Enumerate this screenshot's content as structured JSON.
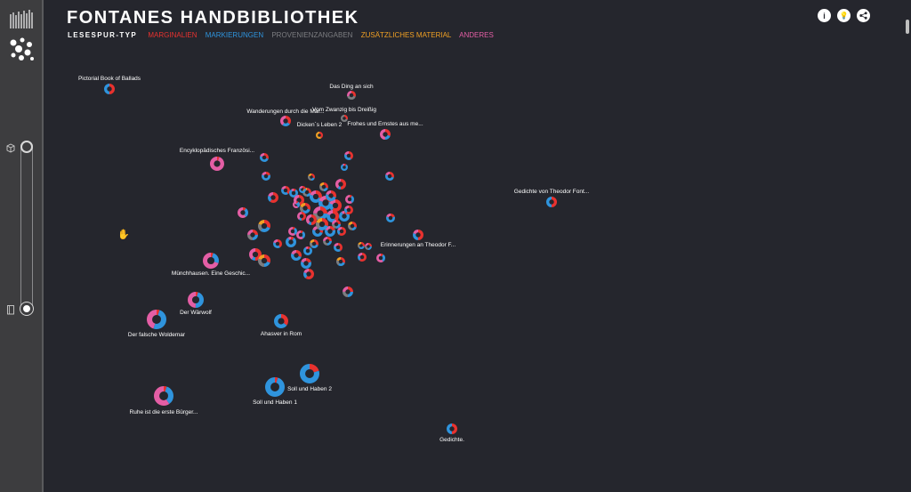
{
  "app": {
    "title": "FONTANES HANDBIBLIOTHEK"
  },
  "legend": {
    "label": "LESESPUR-TYP",
    "items": [
      {
        "label": "MARGINALIEN",
        "color": "#e8322f"
      },
      {
        "label": "MARKIERUNGEN",
        "color": "#2f94dd"
      },
      {
        "label": "PROVENIENZANGABEN",
        "color": "#7c7d80"
      },
      {
        "label": "ZUSÄTZLICHES MATERIAL",
        "color": "#f0a024"
      },
      {
        "label": "ANDERES",
        "color": "#e45ea5"
      }
    ]
  },
  "toolbar": [
    {
      "icon": "info-icon",
      "glyph": "i"
    },
    {
      "icon": "lightbulb-icon",
      "glyph": "💡"
    },
    {
      "icon": "share-icon",
      "glyph": "⤴"
    }
  ],
  "books": [
    {
      "label": "Pictorial Book of Ballads",
      "shares": [
        0.5,
        0.5,
        0,
        0,
        0
      ]
    },
    {
      "label": "Das Ding an sich",
      "shares": [
        0.3,
        0,
        0.4,
        0,
        0.3
      ]
    },
    {
      "label": "Wanderungen durch die Mar...",
      "shares": [
        0.35,
        0.25,
        0,
        0,
        0.4
      ]
    },
    {
      "label": "Vom Zwanzig bis Dreißig",
      "shares": [
        0.3,
        0,
        0.7,
        0,
        0
      ]
    },
    {
      "label": "Dicken´s Leben 2",
      "shares": [
        0.4,
        0,
        0,
        0.6,
        0
      ]
    },
    {
      "label": "Frohes und Ernstes aus me...",
      "shares": [
        0.3,
        0.2,
        0,
        0,
        0.5
      ]
    },
    {
      "label": "Encyklopädisches Französi...",
      "shares": [
        0.05,
        0,
        0,
        0,
        0.95
      ]
    },
    {
      "label": "Gedichte von Theodor Font...",
      "shares": [
        0.5,
        0.5,
        0,
        0,
        0
      ]
    },
    {
      "label": "Erinnerungen an Theodor F...",
      "shares": [
        0.5,
        0.3,
        0,
        0,
        0.2
      ]
    },
    {
      "label": "Münchhausen. Eine Geschic...",
      "shares": [
        0.05,
        0.25,
        0,
        0,
        0.7
      ]
    },
    {
      "label": "Der Wärwolf",
      "shares": [
        0.05,
        0.45,
        0,
        0,
        0.5
      ]
    },
    {
      "label": "Der falsche Woldemar",
      "shares": [
        0.05,
        0.5,
        0,
        0,
        0.45
      ]
    },
    {
      "label": "Ahasver in Rom",
      "shares": [
        0.35,
        0.65,
        0,
        0,
        0
      ]
    },
    {
      "label": "Soll und Haben 2",
      "shares": [
        0.2,
        0.8,
        0,
        0,
        0
      ]
    },
    {
      "label": "Soll und Haben 1",
      "shares": [
        0.05,
        0.95,
        0,
        0,
        0
      ]
    },
    {
      "label": "Ruhe ist die erste Bürger...",
      "shares": [
        0.05,
        0.35,
        0,
        0,
        0.6
      ]
    },
    {
      "label": "Gedichte.",
      "shares": [
        0.5,
        0.5,
        0,
        0,
        0
      ]
    },
    {
      "label": "",
      "shares": [
        0.3,
        0.5,
        0,
        0,
        0.2
      ]
    },
    {
      "label": "",
      "shares": [
        0.2,
        0.6,
        0,
        0,
        0.2
      ]
    },
    {
      "label": "",
      "shares": [
        0.6,
        0.2,
        0,
        0,
        0.2
      ]
    },
    {
      "label": "",
      "shares": [
        0.1,
        0.3,
        0,
        0,
        0.6
      ]
    },
    {
      "label": "",
      "shares": [
        0.3,
        0.3,
        0.2,
        0.2,
        0
      ]
    },
    {
      "label": "",
      "shares": [
        0.25,
        0.25,
        0.25,
        0,
        0.25
      ]
    },
    {
      "label": "",
      "shares": [
        0.4,
        0.4,
        0,
        0,
        0.2
      ]
    },
    {
      "label": "",
      "shares": [
        0.1,
        0.8,
        0,
        0,
        0.1
      ]
    },
    {
      "label": "",
      "shares": [
        0.5,
        0.1,
        0,
        0,
        0.4
      ]
    },
    {
      "label": "",
      "shares": [
        0.3,
        0.2,
        0.3,
        0.2,
        0
      ]
    }
  ]
}
